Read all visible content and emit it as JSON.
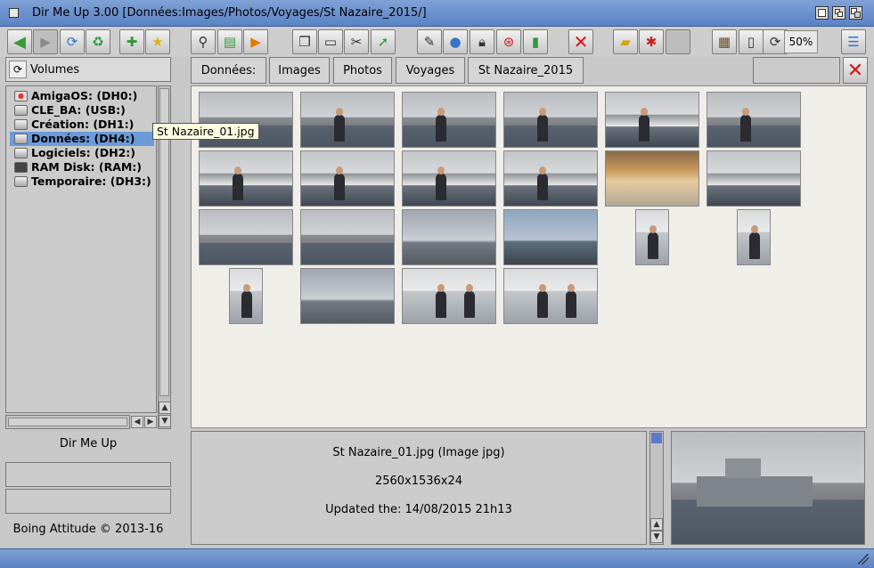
{
  "window": {
    "title": "Dir Me Up 3.00 [Données:Images/Photos/Voyages/St Nazaire_2015/]"
  },
  "toolbar": {
    "buttons": [
      {
        "icon": "back-arrow-icon",
        "enabled": true
      },
      {
        "icon": "forward-arrow-icon",
        "enabled": false
      },
      {
        "icon": "refresh-icon",
        "enabled": true
      },
      {
        "icon": "reload-all-icon",
        "enabled": true
      },
      {
        "icon": "add-volume-icon",
        "enabled": true
      },
      {
        "icon": "favorite-star-icon",
        "enabled": true
      },
      {
        "icon": "search-icon",
        "enabled": true
      },
      {
        "icon": "film-icon",
        "enabled": true
      },
      {
        "icon": "play-icon",
        "enabled": true
      },
      {
        "icon": "copy-icon",
        "enabled": true
      },
      {
        "icon": "paste-icon",
        "enabled": true
      },
      {
        "icon": "cut-icon",
        "enabled": true
      },
      {
        "icon": "move-icon",
        "enabled": true
      },
      {
        "icon": "edit-icon",
        "enabled": true
      },
      {
        "icon": "comment-icon",
        "enabled": true
      },
      {
        "icon": "lock-icon",
        "enabled": true
      },
      {
        "icon": "help-icon",
        "enabled": true
      },
      {
        "icon": "book-icon",
        "enabled": true
      },
      {
        "icon": "delete-icon",
        "enabled": true
      },
      {
        "icon": "new-drawer-icon",
        "enabled": true
      },
      {
        "icon": "tools-icon",
        "enabled": true
      },
      {
        "icon": "blank-icon",
        "enabled": false
      },
      {
        "icon": "thumbnail-view-icon",
        "enabled": true
      },
      {
        "icon": "list-view-icon",
        "enabled": true
      },
      {
        "icon": "rotate-icon",
        "enabled": true
      },
      {
        "icon": "settings-sliders-icon",
        "enabled": true
      }
    ],
    "zoom_label": "50%"
  },
  "sidebar": {
    "volumes_label": "Volumes",
    "volumes": [
      {
        "label": "AmigaOS: (DH0:)",
        "selected": false
      },
      {
        "label": "CLE_BA: (USB:)",
        "selected": false
      },
      {
        "label": "Création: (DH1:)",
        "selected": false
      },
      {
        "label": "Données: (DH4:)",
        "selected": true
      },
      {
        "label": "Logiciels: (DH2:)",
        "selected": false
      },
      {
        "label": "RAM Disk: (RAM:)",
        "selected": false
      },
      {
        "label": "Temporaire: (DH3:)",
        "selected": false
      }
    ],
    "app_name": "Dir Me Up",
    "copyright": "Boing Attitude © 2013-16"
  },
  "breadcrumb": [
    "Données:",
    "Images",
    "Photos",
    "Voyages",
    "St Nazaire_2015"
  ],
  "tooltip": "St Nazaire_01.jpg",
  "thumbnails": [
    {
      "kind": "ship",
      "people": 0
    },
    {
      "kind": "ship",
      "people": 1
    },
    {
      "kind": "ship",
      "people": 1
    },
    {
      "kind": "ship",
      "people": 1
    },
    {
      "kind": "boat",
      "people": 1
    },
    {
      "kind": "ship",
      "people": 1
    },
    {
      "kind": "boat",
      "people": 1
    },
    {
      "kind": "boat",
      "people": 1
    },
    {
      "kind": "boat",
      "people": 1
    },
    {
      "kind": "boat",
      "people": 1
    },
    {
      "kind": "baby",
      "people": 0
    },
    {
      "kind": "boat",
      "people": 0
    },
    {
      "kind": "ship",
      "people": 0
    },
    {
      "kind": "ship",
      "people": 0
    },
    {
      "kind": "sea",
      "people": 0
    },
    {
      "kind": "sky",
      "people": 0
    },
    {
      "kind": "people",
      "people": 1,
      "portrait": true
    },
    {
      "kind": "people",
      "people": 1,
      "portrait": true
    },
    {
      "kind": "people",
      "people": 1,
      "portrait": true
    },
    {
      "kind": "sea",
      "people": 0
    },
    {
      "kind": "people",
      "people": 2
    },
    {
      "kind": "people",
      "people": 2
    }
  ],
  "info": {
    "filename": "St Nazaire_01.jpg (Image jpg)",
    "dimensions": "2560x1536x24",
    "updated": "Updated the: 14/08/2015 21h13"
  }
}
